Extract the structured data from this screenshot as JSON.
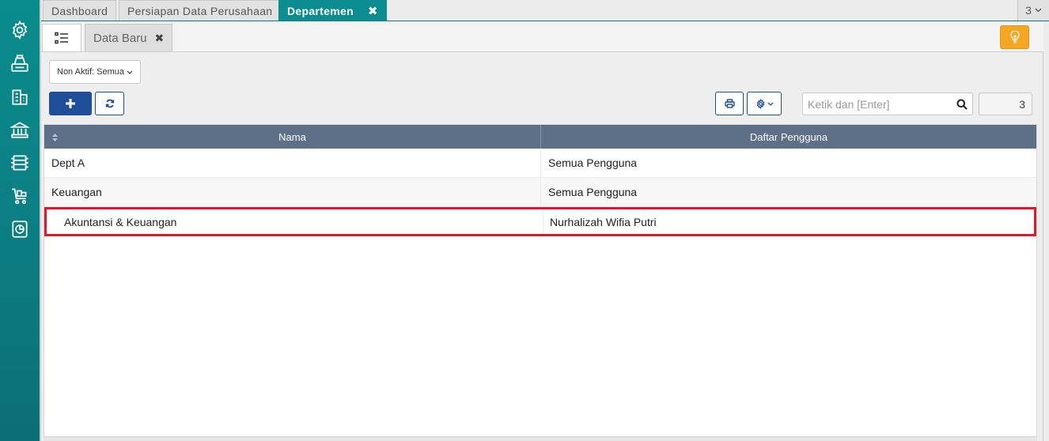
{
  "tabs": [
    {
      "label": "Dashboard"
    },
    {
      "label": "Persiapan Data Perusahaan"
    },
    {
      "label": "Departemen"
    }
  ],
  "tab_count": "3",
  "subtabs": {
    "form_label": "Data Baru"
  },
  "filter": {
    "label": "Non Aktif: Semua"
  },
  "search": {
    "placeholder": "Ketik dan [Enter]"
  },
  "record_count": "3",
  "table": {
    "headers": {
      "nama": "Nama",
      "pengguna": "Daftar Pengguna"
    },
    "rows": [
      {
        "nama": "Dept A",
        "pengguna": "Semua Pengguna"
      },
      {
        "nama": "Keuangan",
        "pengguna": "Semua Pengguna"
      },
      {
        "nama": "Akuntansi & Keuangan",
        "pengguna": "Nurhalizah Wifia Putri"
      }
    ]
  },
  "colors": {
    "sidebar": "#0a8c8c",
    "active_tab": "#0a8c91",
    "primary_button": "#1f4e9a",
    "header": "#5d7088",
    "highlight": "#e0182a",
    "bulb_button": "#f5a623"
  },
  "icons": [
    "settings-icon",
    "cash-register-icon",
    "building-icon",
    "bank-icon",
    "inventory-icon",
    "cart-icon",
    "report-icon",
    "list-icon",
    "lightbulb-icon",
    "plus-icon",
    "refresh-icon",
    "print-icon",
    "gear-icon",
    "search-icon"
  ]
}
